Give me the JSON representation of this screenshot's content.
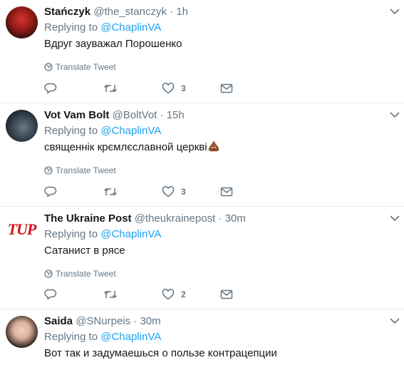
{
  "tweets": [
    {
      "name": "Stańczyk",
      "handle": "@the_stanczyk",
      "time": "1h",
      "replying_label": "Replying to",
      "replying_to": "@ChaplinVA",
      "text": "Вдруг зауважал Порошенко",
      "translate": "Translate Tweet",
      "likes": "3",
      "avatar_icon": "red-figure-avatar"
    },
    {
      "name": "Vot Vam Bolt",
      "handle": "@BoltVot",
      "time": "15h",
      "replying_label": "Replying to",
      "replying_to": "@ChaplinVA",
      "text": "священнік крємлєславной церкві",
      "emoji": "pile-of-poo-emoji",
      "translate": "Translate Tweet",
      "likes": "3",
      "avatar_icon": "bolt-avatar"
    },
    {
      "name": "The Ukraine Post",
      "handle": "@theukrainepost",
      "time": "30m",
      "replying_label": "Replying to",
      "replying_to": "@ChaplinVA",
      "text": "Сатанист в рясе",
      "translate": "Translate Tweet",
      "likes": "2",
      "avatar_logo": "TUP",
      "avatar_icon": "tup-logo"
    },
    {
      "name": "Saida",
      "handle": "@SNurpeis",
      "time": "30m",
      "replying_label": "Replying to",
      "replying_to": "@ChaplinVA",
      "text": "Вот так и задумаешься о пользе контрацепции",
      "avatar_icon": "woman-portrait-avatar"
    }
  ],
  "separator": "·",
  "colors": {
    "link": "#1da1f2",
    "secondary": "#657786",
    "text": "#14171a",
    "divider": "#e6ecf0"
  }
}
